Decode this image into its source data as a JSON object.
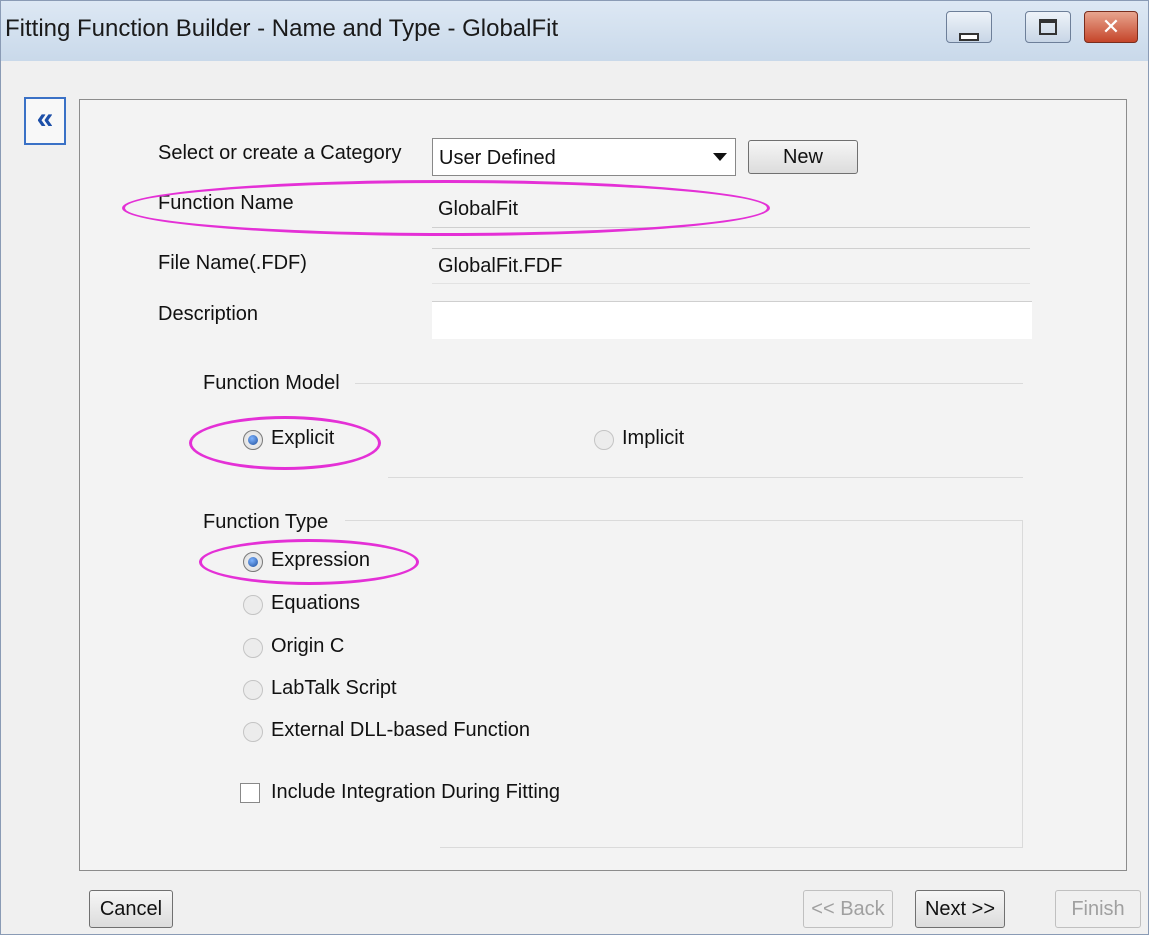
{
  "window": {
    "title": "Fitting Function Builder - Name and Type - GlobalFit"
  },
  "collapse": {
    "glyph": "«"
  },
  "category": {
    "label": "Select or create a Category",
    "value": "User Defined",
    "new_button": "New"
  },
  "function_name": {
    "label": "Function Name",
    "value": "GlobalFit"
  },
  "file_name": {
    "label": "File Name(.FDF)",
    "value": "GlobalFit.FDF"
  },
  "description": {
    "label": "Description",
    "value": ""
  },
  "function_model": {
    "label": "Function Model",
    "options": [
      {
        "label": "Explicit",
        "selected": true
      },
      {
        "label": "Implicit",
        "selected": false
      }
    ]
  },
  "function_type": {
    "label": "Function Type",
    "options": [
      {
        "label": "Expression",
        "selected": true
      },
      {
        "label": "Equations",
        "selected": false
      },
      {
        "label": "Origin C",
        "selected": false
      },
      {
        "label": "LabTalk Script",
        "selected": false
      },
      {
        "label": "External DLL-based Function",
        "selected": false
      }
    ],
    "include_integration": {
      "label": "Include Integration During Fitting",
      "checked": false
    }
  },
  "footer": {
    "cancel": "Cancel",
    "back": "<< Back",
    "next": "Next >>",
    "finish": "Finish"
  },
  "colors": {
    "highlight": "#e430d6",
    "accent": "#3a71c6"
  }
}
